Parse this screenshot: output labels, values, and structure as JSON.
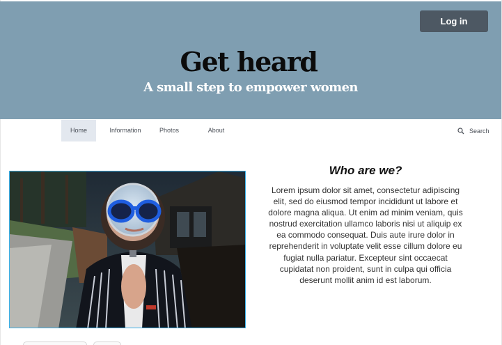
{
  "header": {
    "login_label": "Log in",
    "title": "Get heard",
    "subtitle": "A small step to empower women",
    "background_color": "#7f9eb1"
  },
  "nav": {
    "items": [
      {
        "label": "Home",
        "active": true
      },
      {
        "label": "Information",
        "active": false
      },
      {
        "label": "Photos",
        "active": false
      },
      {
        "label": "About",
        "active": false
      }
    ],
    "search_label": "Search",
    "search_icon": "search-icon"
  },
  "about": {
    "heading": "Who are we?",
    "body": "Lorem ipsum dolor sit amet, consectetur adipiscing elit, sed do eiusmod tempor incididunt ut labore et dolore magna aliqua. Ut enim ad minim veniam, quis nostrud exercitation ullamco laboris nisi ut aliquip ex ea commodo consequat. Duis aute irure dolor in reprehenderit in voluptate velit esse cillum dolore eu fugiat nulla pariatur. Excepteur sint occaecat cupidatat non proident, sunt in culpa qui officia deserunt mollit anim id est laborum."
  },
  "colors": {
    "accent_border": "#3bb0e8",
    "button": "#4d5863",
    "active_tab": "#e3e8ef"
  }
}
